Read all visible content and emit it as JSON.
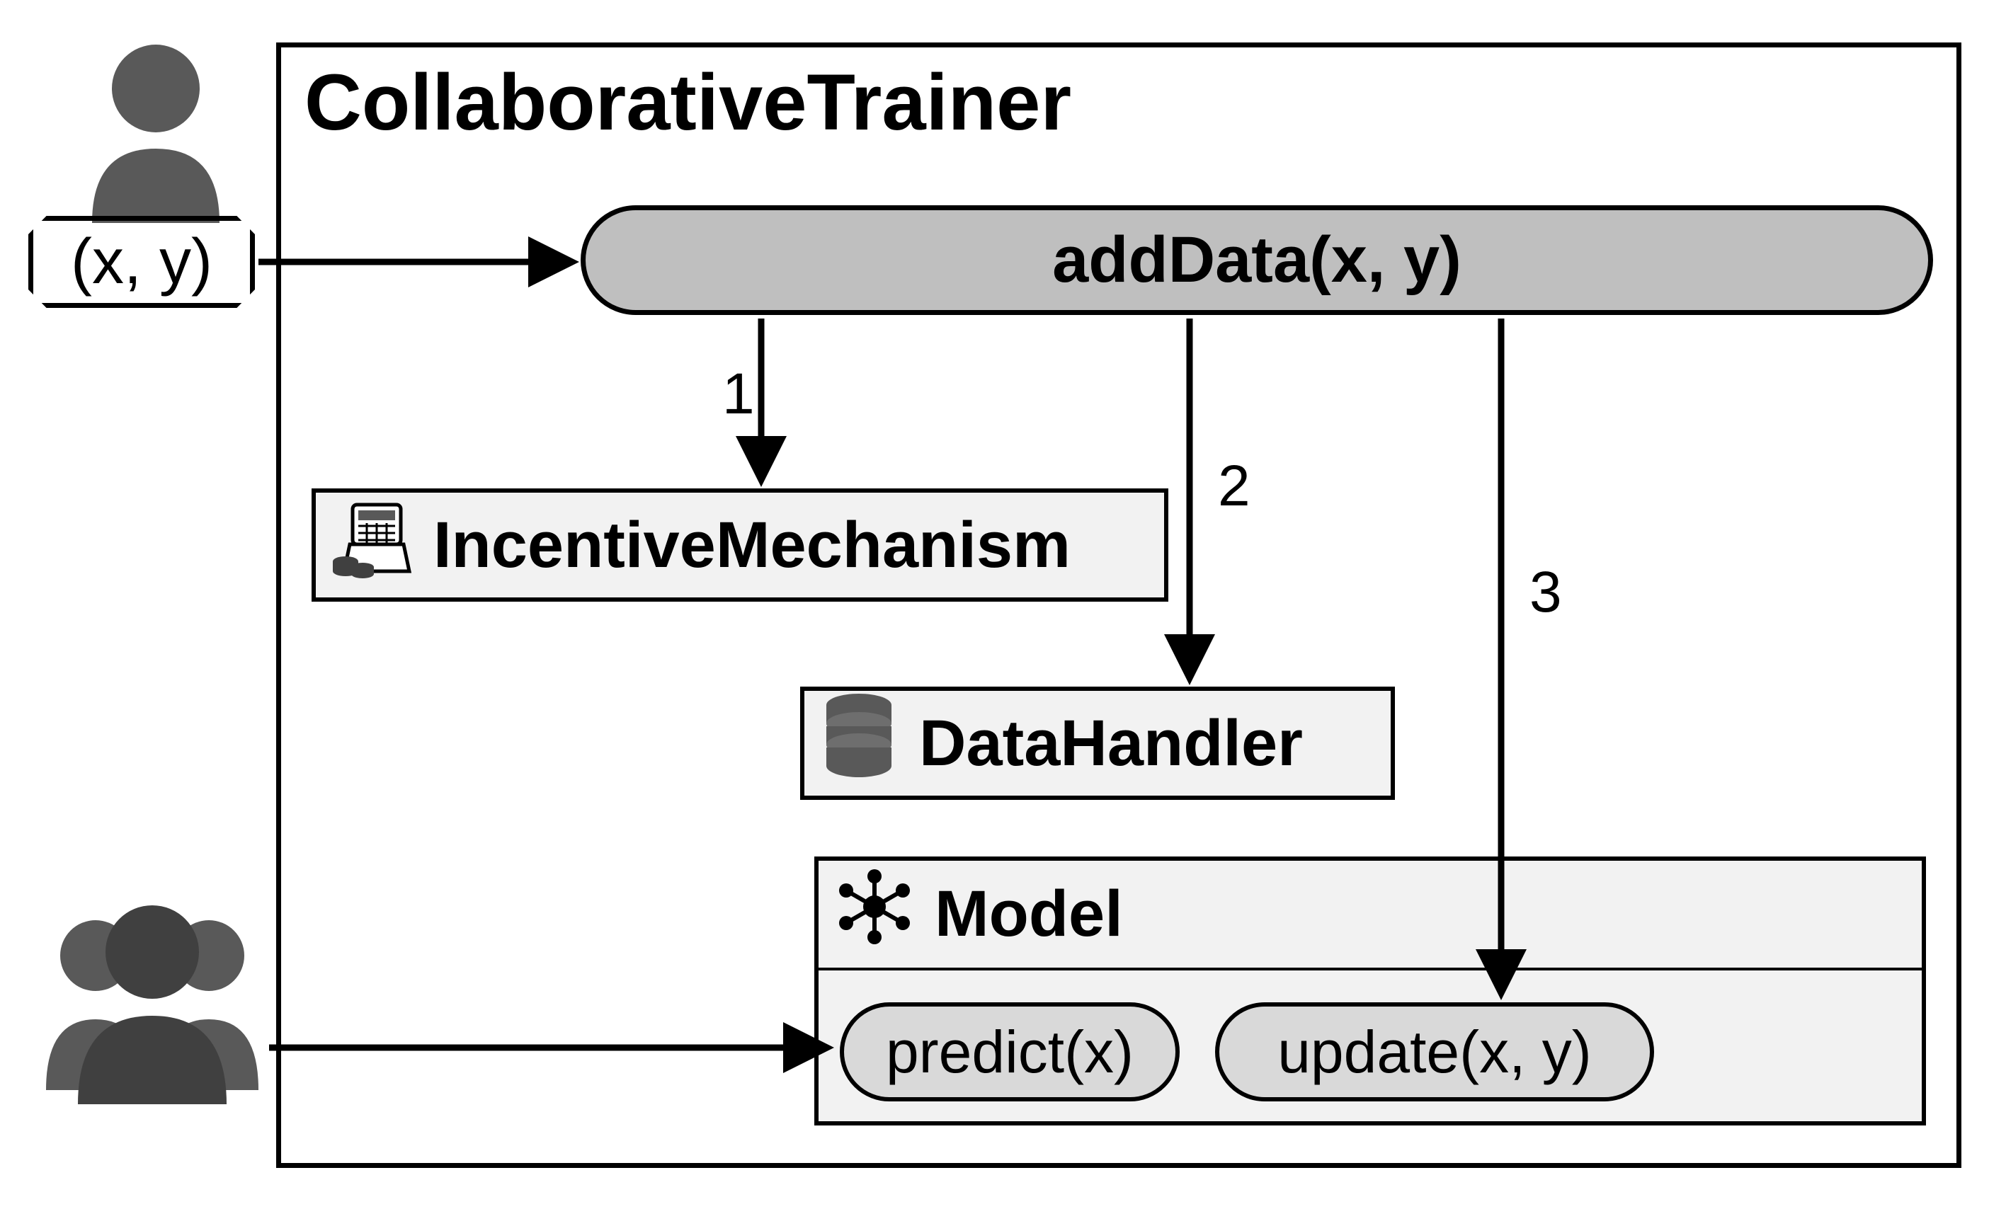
{
  "title": "CollaborativeTrainer",
  "input_label": "(x, y)",
  "add_data": "addData(x, y)",
  "steps": {
    "one": "1",
    "two": "2",
    "three": "3"
  },
  "incentive": {
    "label": "IncentiveMechanism"
  },
  "data_handler": {
    "label": "DataHandler"
  },
  "model": {
    "label": "Model",
    "predict": "predict(x)",
    "update": "update(x, y)"
  }
}
